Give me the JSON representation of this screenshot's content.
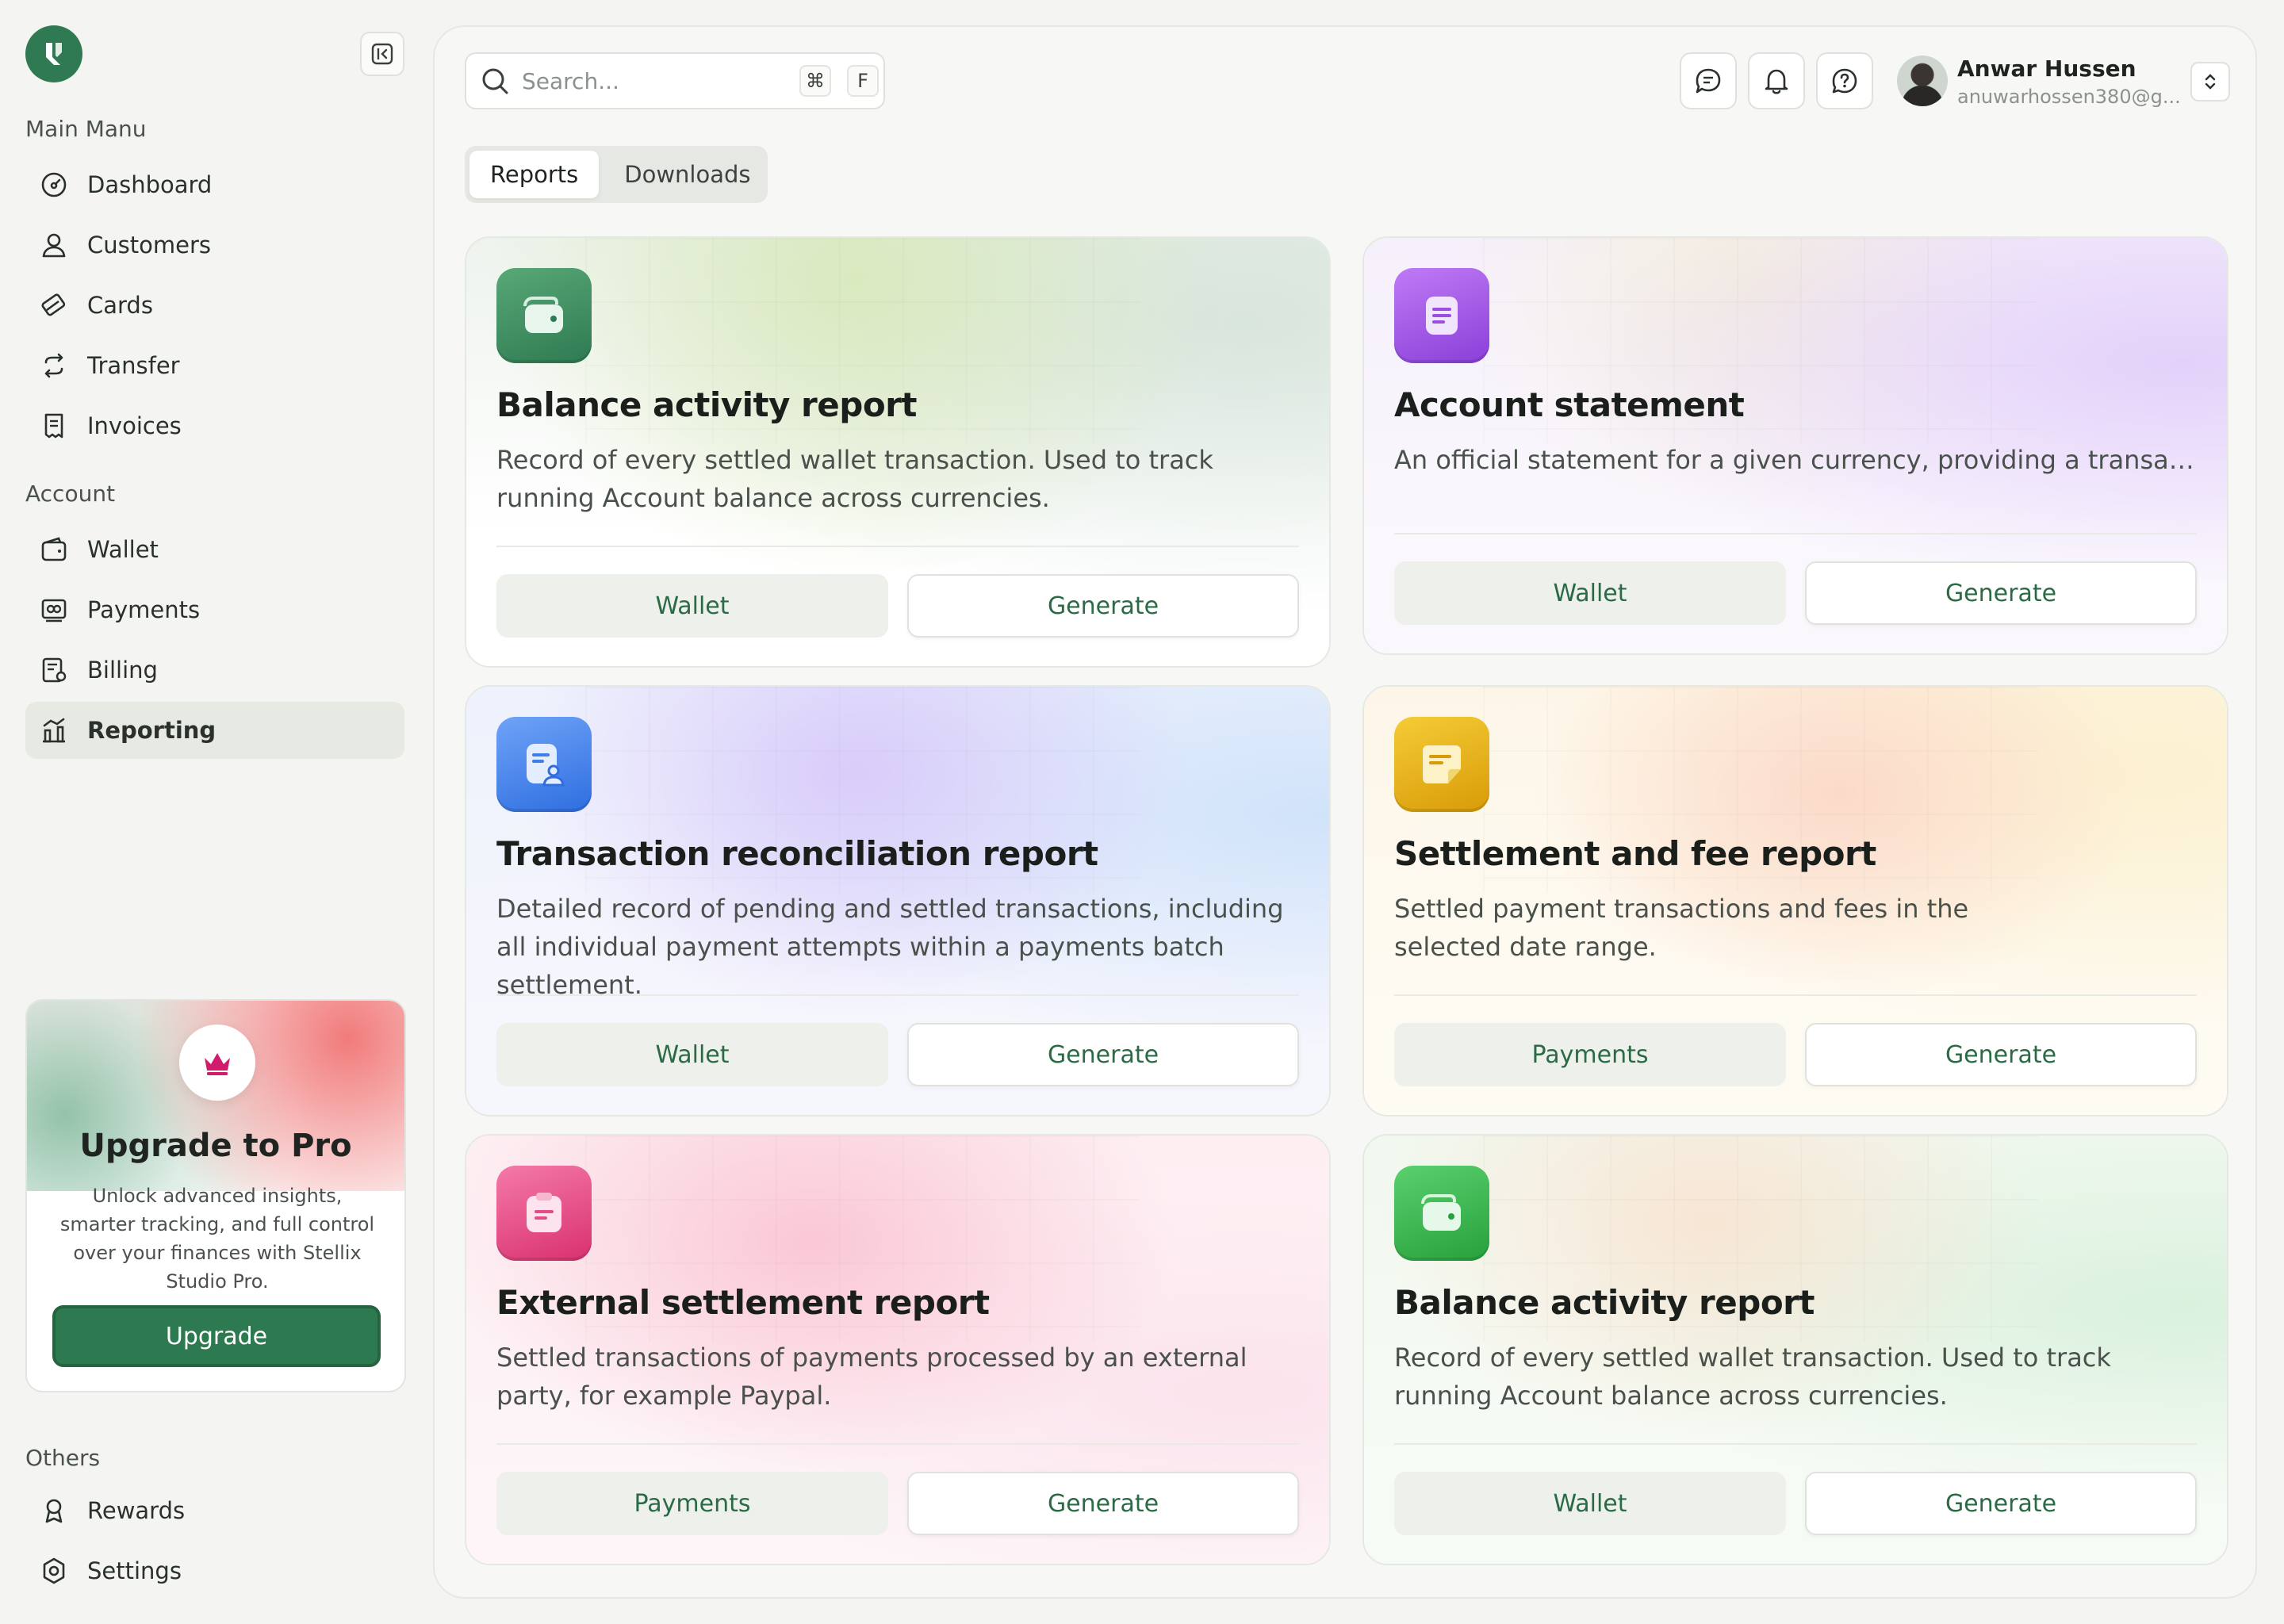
{
  "sidebar": {
    "main_menu_label": "Main Manu",
    "main_items": [
      {
        "label": "Dashboard",
        "icon": "dashboard-icon"
      },
      {
        "label": "Customers",
        "icon": "user-icon"
      },
      {
        "label": "Cards",
        "icon": "cards-icon"
      },
      {
        "label": "Transfer",
        "icon": "transfer-icon"
      },
      {
        "label": "Invoices",
        "icon": "invoice-icon"
      }
    ],
    "account_label": "Account",
    "account_items": [
      {
        "label": "Wallet",
        "icon": "wallet-icon"
      },
      {
        "label": "Payments",
        "icon": "payments-icon"
      },
      {
        "label": "Billing",
        "icon": "billing-icon"
      },
      {
        "label": "Reporting",
        "icon": "reporting-icon",
        "active": true
      }
    ],
    "others_label": "Others",
    "other_items": [
      {
        "label": "Rewards",
        "icon": "rewards-icon"
      },
      {
        "label": "Settings",
        "icon": "settings-icon"
      }
    ],
    "upgrade": {
      "title": "Upgrade to Pro",
      "description": "Unlock advanced insights, smarter tracking, and full control over your finances with Stellix Studio Pro.",
      "button": "Upgrade"
    }
  },
  "header": {
    "search_placeholder": "Search...",
    "shortcut_keys": [
      "⌘",
      "F"
    ],
    "user_name": "Anwar Hussen",
    "user_email": "anuwarhossen380@g..."
  },
  "tabs": [
    {
      "label": "Reports",
      "active": true
    },
    {
      "label": "Downloads",
      "active": false
    }
  ],
  "cards": [
    {
      "title": "Balance activity report",
      "description": "Record of every settled wallet transaction. Used to track running Account balance across currencies.",
      "source_button": "Wallet",
      "action_button": "Generate",
      "accent": "#3f8f5f"
    },
    {
      "title": "Account statement",
      "description": "An official statement for a given currency, providing a transaction...",
      "source_button": "Wallet",
      "action_button": "Generate",
      "accent": "#9b4fe0"
    },
    {
      "title": "Transaction reconciliation report",
      "description": "Detailed record of pending and settled transactions, including all individual payment attempts within a payments batch settlement.",
      "source_button": "Wallet",
      "action_button": "Generate",
      "accent": "#3d7ee8"
    },
    {
      "title": "Settlement and fee report",
      "description": "Settled payment transactions and fees in the selected date range.",
      "source_button": "Payments",
      "action_button": "Generate",
      "accent": "#e0a910"
    },
    {
      "title": "External settlement report",
      "description": "Settled transactions of payments processed by an external party, for example Paypal.",
      "source_button": "Payments",
      "action_button": "Generate",
      "accent": "#e44d8a"
    },
    {
      "title": "Balance activity report",
      "description": "Record of every settled wallet transaction. Used to track running Account balance across currencies.",
      "source_button": "Wallet",
      "action_button": "Generate",
      "accent": "#33b84a"
    }
  ]
}
